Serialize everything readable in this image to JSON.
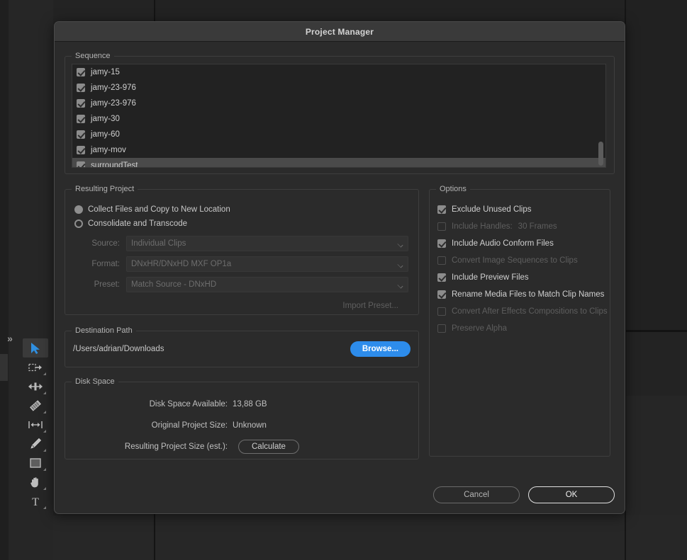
{
  "background": {
    "expand_chevron": "»",
    "tools": [
      {
        "name": "selection-tool",
        "active": true
      },
      {
        "name": "track-select-forward-tool",
        "active": false
      },
      {
        "name": "ripple-edit-tool",
        "active": false
      },
      {
        "name": "razor-tool",
        "active": false
      },
      {
        "name": "slip-tool",
        "active": false
      },
      {
        "name": "pen-tool",
        "active": false
      },
      {
        "name": "rectangle-tool",
        "active": false
      },
      {
        "name": "hand-tool",
        "active": false
      },
      {
        "name": "type-tool",
        "active": false
      }
    ]
  },
  "dialog": {
    "title": "Project Manager",
    "sequence": {
      "legend": "Sequence",
      "items": [
        {
          "label": "jamy-15",
          "checked": true,
          "selected": false
        },
        {
          "label": "jamy-23-976",
          "checked": true,
          "selected": false
        },
        {
          "label": "jamy-23-976",
          "checked": true,
          "selected": false
        },
        {
          "label": "jamy-30",
          "checked": true,
          "selected": false
        },
        {
          "label": "jamy-60",
          "checked": true,
          "selected": false
        },
        {
          "label": "jamy-mov",
          "checked": true,
          "selected": false
        },
        {
          "label": "surroundTest",
          "checked": true,
          "selected": true
        }
      ]
    },
    "resulting_project": {
      "legend": "Resulting Project",
      "radios": [
        {
          "label": "Collect Files and Copy to New Location",
          "selected": true
        },
        {
          "label": "Consolidate and Transcode",
          "selected": false
        }
      ],
      "fields": [
        {
          "label": "Source:",
          "value": "Individual Clips",
          "disabled": true
        },
        {
          "label": "Format:",
          "value": "DNxHR/DNxHD MXF OP1a",
          "disabled": true
        },
        {
          "label": "Preset:",
          "value": "Match Source - DNxHD",
          "disabled": true
        }
      ],
      "import_preset_label": "Import Preset..."
    },
    "destination_path": {
      "legend": "Destination Path",
      "path": "/Users/adrian/Downloads",
      "browse_label": "Browse..."
    },
    "disk_space": {
      "legend": "Disk Space",
      "rows": [
        {
          "label": "Disk Space Available:",
          "value": "13,88 GB"
        },
        {
          "label": "Original Project Size:",
          "value": "Unknown"
        },
        {
          "label": "Resulting Project Size (est.):",
          "value": ""
        }
      ],
      "calculate_label": "Calculate"
    },
    "options": {
      "legend": "Options",
      "items": [
        {
          "label": "Exclude Unused Clips",
          "checked": true,
          "disabled": false,
          "sub": ""
        },
        {
          "label": "Include Handles:",
          "checked": false,
          "disabled": true,
          "sub": "30 Frames"
        },
        {
          "label": "Include Audio Conform Files",
          "checked": true,
          "disabled": false,
          "sub": ""
        },
        {
          "label": "Convert Image Sequences to Clips",
          "checked": false,
          "disabled": true,
          "sub": ""
        },
        {
          "label": "Include Preview Files",
          "checked": true,
          "disabled": false,
          "sub": ""
        },
        {
          "label": "Rename Media Files to Match Clip Names",
          "checked": true,
          "disabled": false,
          "sub": ""
        },
        {
          "label": "Convert After Effects Compositions to Clips",
          "checked": false,
          "disabled": true,
          "sub": ""
        },
        {
          "label": "Preserve Alpha",
          "checked": false,
          "disabled": true,
          "sub": ""
        }
      ]
    },
    "footer": {
      "cancel_label": "Cancel",
      "ok_label": "OK"
    }
  },
  "colors": {
    "accent_blue": "#2d8ceb",
    "dialog_bg": "#2b2b2b",
    "titlebar_bg": "#3a3a3a",
    "selection_row": "#4a4a4a",
    "tool_active_blue": "#2f8fe0"
  }
}
